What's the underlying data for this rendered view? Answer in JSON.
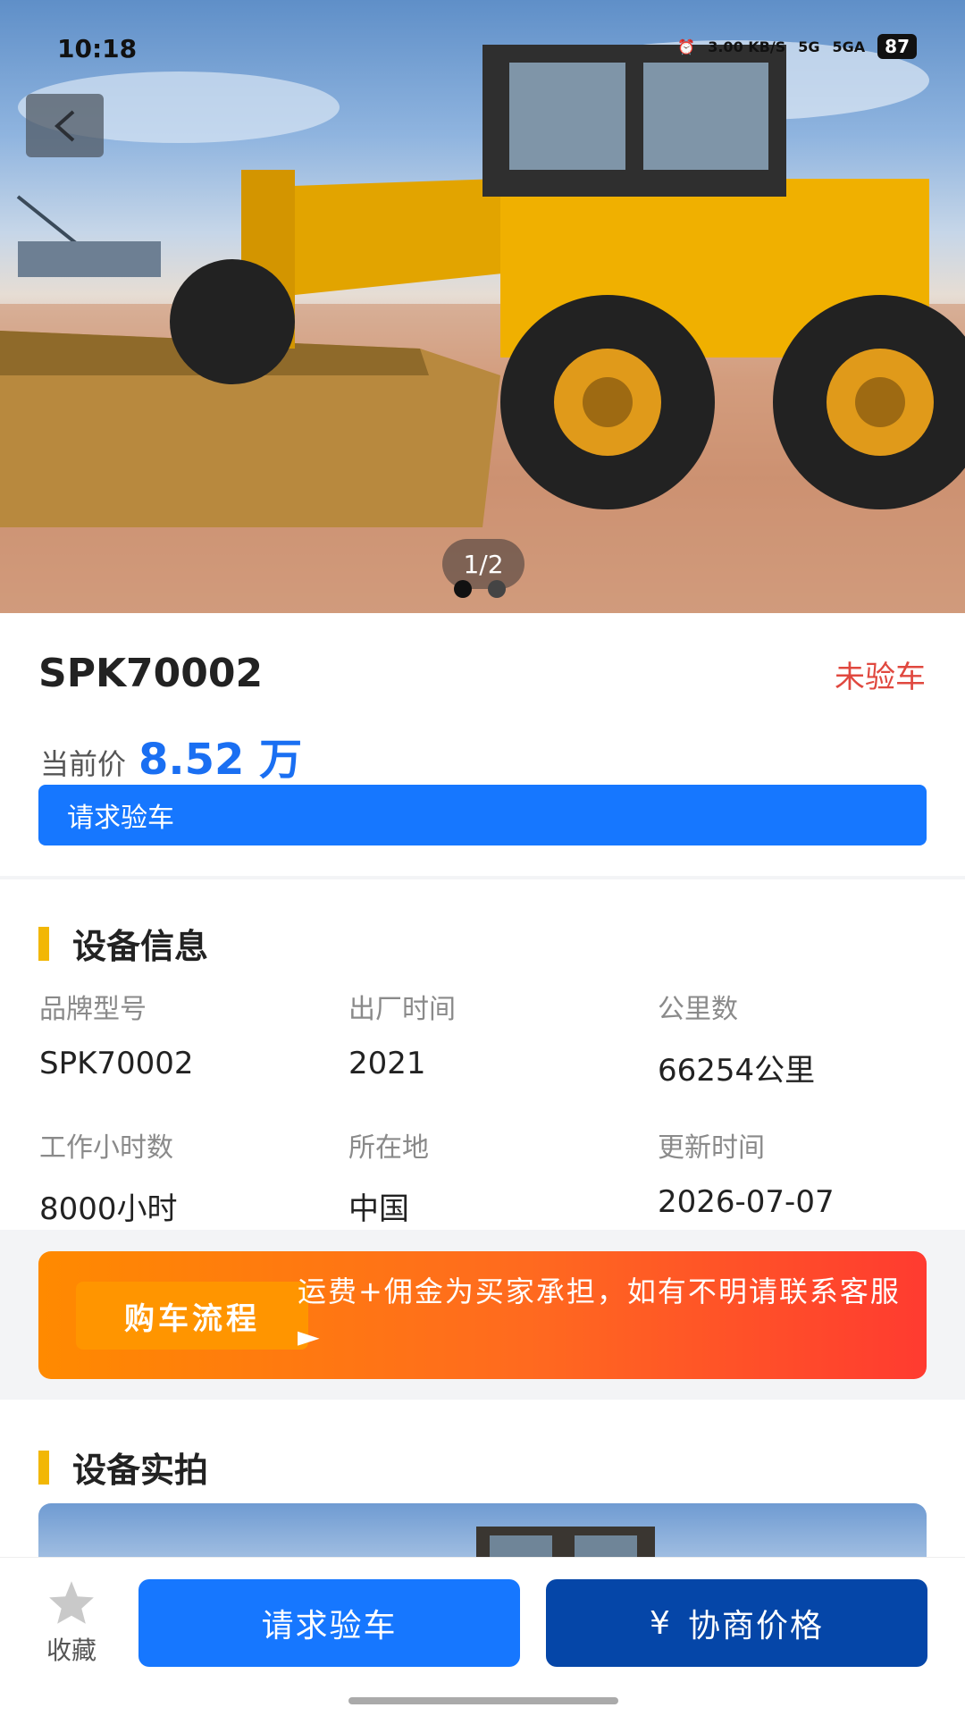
{
  "status_bar": {
    "time": "10:18",
    "net_speed": "3.00 KB/S",
    "signal_1": "5G",
    "signal_2": "5GA",
    "battery": "87"
  },
  "hero": {
    "pager": "1/2",
    "dots": 2,
    "active_dot": 0
  },
  "listing": {
    "title": "SPK70002",
    "inspection_status": "未验车",
    "price_label": "当前价",
    "price_value": "8.52 万",
    "request_inspection": "请求验车"
  },
  "equipment_info": {
    "section_title": "设备信息",
    "fields": [
      {
        "label": "品牌型号",
        "value": "SPK70002"
      },
      {
        "label": "出厂时间",
        "value": "2021"
      },
      {
        "label": "公里数",
        "value": "66254公里"
      },
      {
        "label": "工作小时数",
        "value": "8000小时"
      },
      {
        "label": "所在地",
        "value": "中国"
      },
      {
        "label": "更新时间",
        "value": "2026-07-07"
      }
    ]
  },
  "banner": {
    "tag": "购车流程",
    "text": "运费+佣金为买家承担，如有不明请联系客服 ►"
  },
  "photos": {
    "section_title": "设备实拍"
  },
  "bottom_bar": {
    "favorite_label": "收藏",
    "inspect_button": "请求验车",
    "negotiate_symbol": "¥",
    "negotiate_button": "协商价格"
  },
  "colors": {
    "accent_blue": "#1677ff",
    "dark_blue": "#0546a8",
    "status_red": "#e0483f",
    "section_mark": "#f2b705"
  }
}
